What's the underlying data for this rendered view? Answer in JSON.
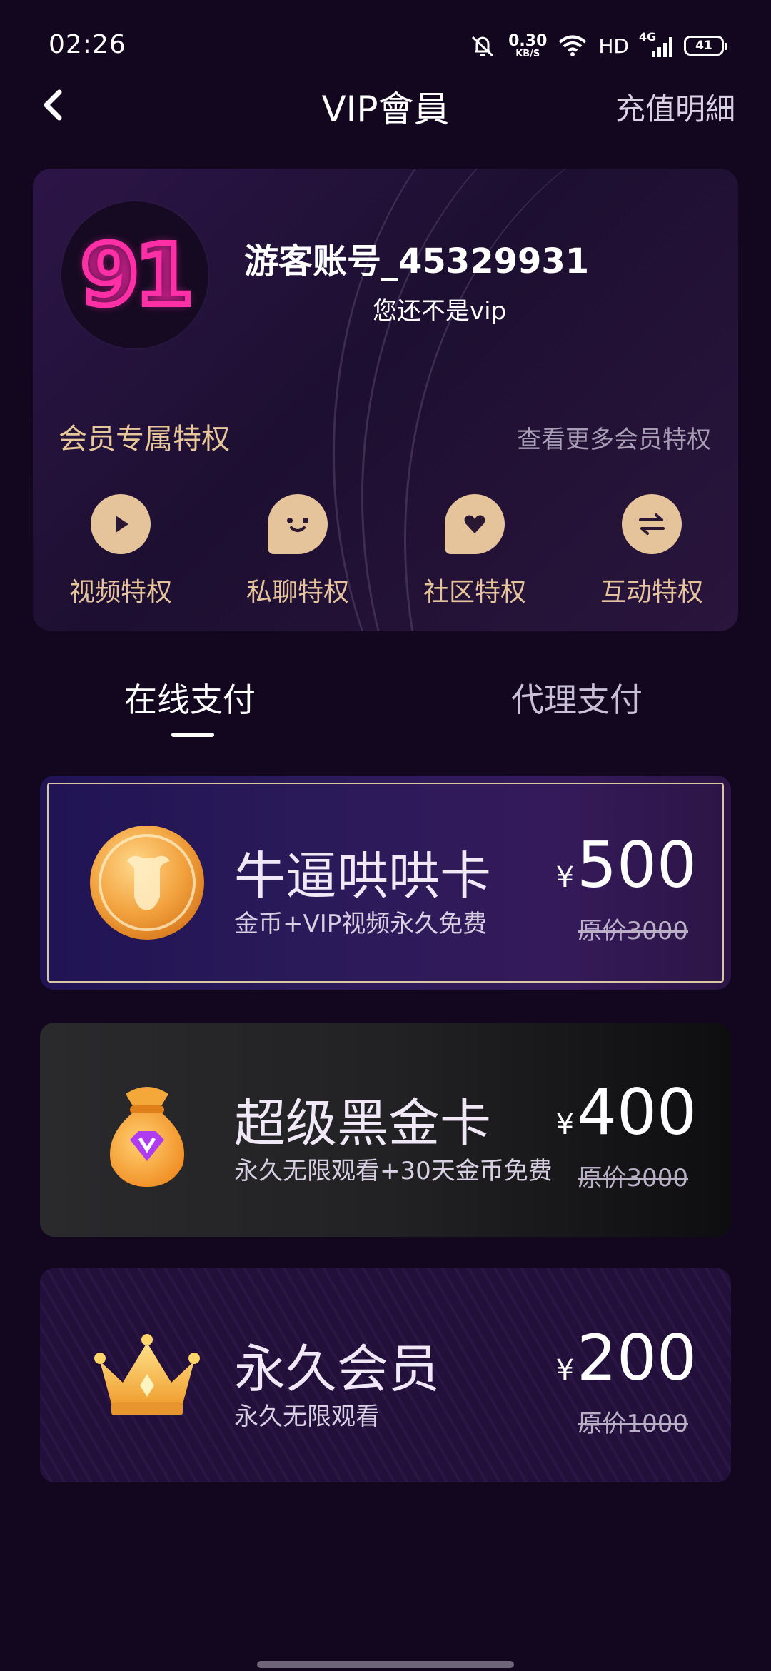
{
  "status_bar": {
    "time": "02:26",
    "net_speed_value": "0.30",
    "net_speed_unit": "KB/S",
    "hd": "HD",
    "network": "4G",
    "battery": "41",
    "icons": [
      "mute-icon",
      "wifi-icon",
      "signal-icon",
      "battery-icon"
    ]
  },
  "header": {
    "title": "VIP會員",
    "recharge_link": "充值明細",
    "back_icon": "chevron-left-icon"
  },
  "member": {
    "avatar_logo": "91",
    "account_name": "游客账号_45329931",
    "vip_status": "您还不是vip",
    "privileges_title": "会员专属特权",
    "privileges_more": "查看更多会员特权",
    "privileges": [
      {
        "label": "视频特权",
        "icon": "play-icon"
      },
      {
        "label": "私聊特权",
        "icon": "chat-icon"
      },
      {
        "label": "社区特权",
        "icon": "heart-bubble-icon"
      },
      {
        "label": "互动特权",
        "icon": "swap-icon"
      }
    ]
  },
  "tabs": [
    {
      "label": "在线支付",
      "active": true
    },
    {
      "label": "代理支付",
      "active": false
    }
  ],
  "plans": [
    {
      "title": "牛逼哄哄卡",
      "desc": "金币+VIP视频永久免费",
      "currency": "¥",
      "price": "500",
      "original": "原价3000",
      "icon": "bull-coin-icon"
    },
    {
      "title": "超级黑金卡",
      "desc": "永久无限观看+30天金币免费",
      "currency": "¥",
      "price": "400",
      "original": "原价3000",
      "icon": "money-bag-icon"
    },
    {
      "title": "永久会员",
      "desc": "永久无限观看",
      "currency": "¥",
      "price": "200",
      "original": "原价1000",
      "icon": "crown-icon"
    }
  ],
  "colors": {
    "background": "#13071f",
    "gold": "#e6c49b",
    "accent_pink": "#ff2fa6"
  }
}
